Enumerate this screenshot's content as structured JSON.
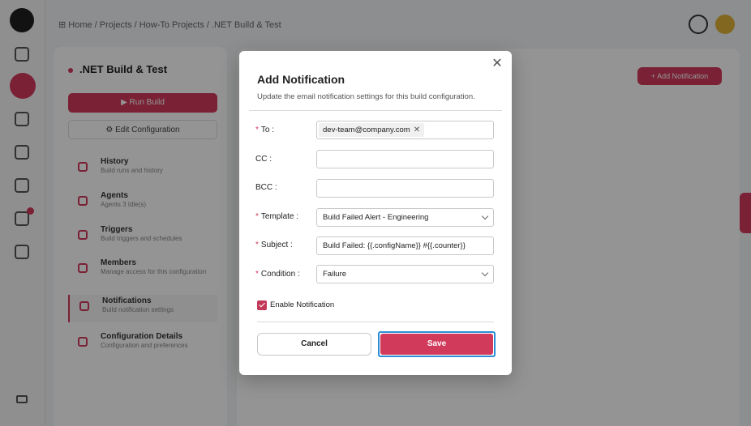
{
  "background": {
    "breadcrumb": "⊞ Home / Projects / How-To Projects / .NET Build & Test",
    "panel_title": ".NET Build & Test",
    "run_button": "▶ Run Build",
    "edit_config": "⚙ Edit Configuration",
    "nav": [
      {
        "title": "History",
        "subtitle": "Build runs and history",
        "icon": "history-icon"
      },
      {
        "title": "Agents",
        "subtitle": "Agents 3 Idle(s)",
        "icon": "agents-icon"
      },
      {
        "title": "Triggers",
        "subtitle": "Build triggers and schedules",
        "icon": "triggers-icon"
      },
      {
        "title": "Members",
        "subtitle": "Manage access for this configuration",
        "icon": "members-icon"
      },
      {
        "title": "Notifications",
        "subtitle": "Build notification settings",
        "icon": "bell-icon"
      },
      {
        "title": "Configuration Details",
        "subtitle": "Configuration and preferences",
        "icon": "details-icon"
      }
    ],
    "add_notification_button": "+ Add Notification"
  },
  "modal": {
    "title": "Add Notification",
    "description": "Update the email notification settings for this build configuration.",
    "to_label": "To :",
    "to_tags": [
      "dev-team@company.com"
    ],
    "cc_label": "CC :",
    "cc_value": "",
    "bcc_label": "BCC :",
    "bcc_value": "",
    "template_label": "Template :",
    "template_value": "Build Failed Alert - Engineering",
    "subject_label": "Subject :",
    "subject_value": "Build Failed: {{.configName}} #{{.counter}}",
    "condition_label": "Condition :",
    "condition_value": "Failure",
    "enable_label": "Enable Notification",
    "enable_checked": true,
    "cancel_label": "Cancel",
    "save_label": "Save"
  },
  "colors": {
    "accent": "#d23a5c",
    "focus_ring": "#2b8fd6"
  }
}
